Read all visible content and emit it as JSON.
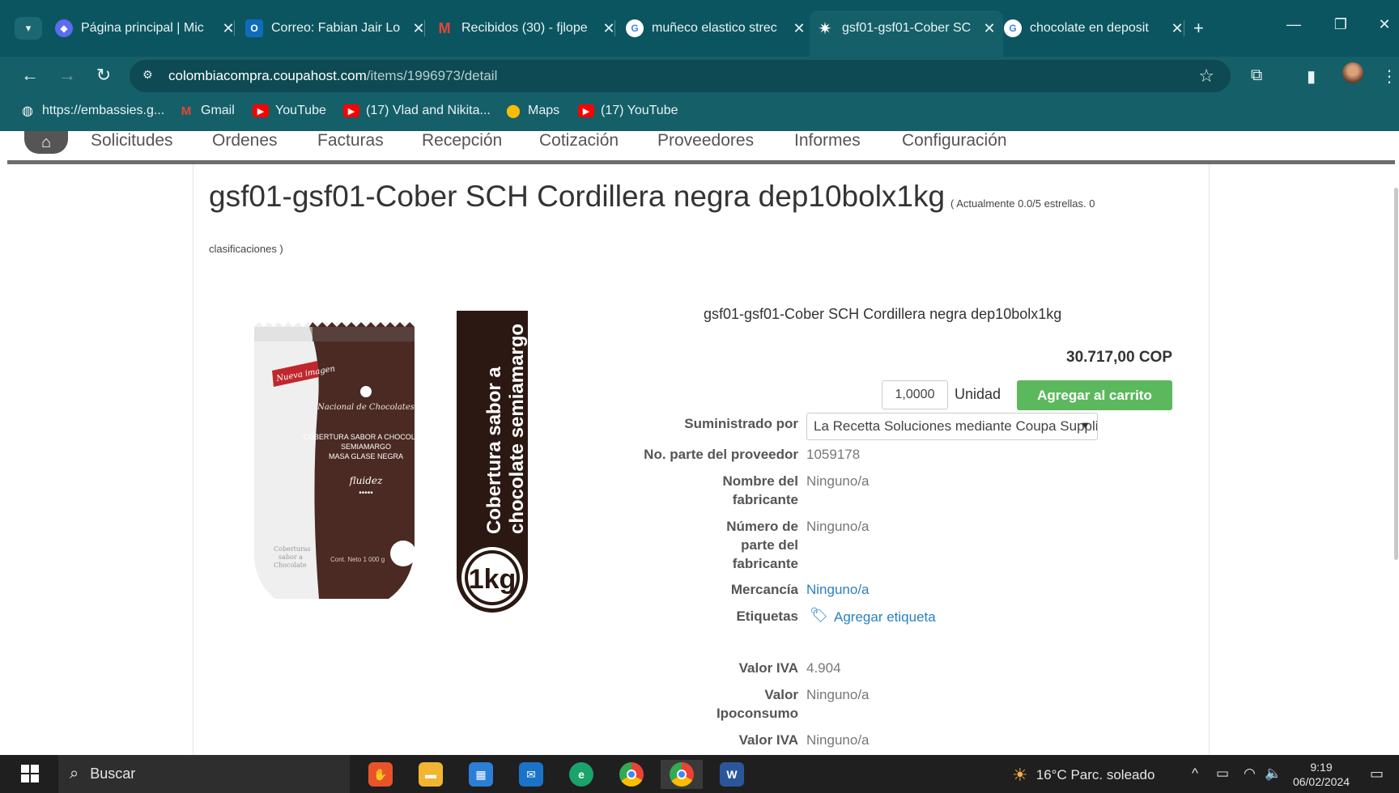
{
  "browser": {
    "tabs": [
      {
        "label": "Página principal | Mic",
        "icon": "copilot-icon",
        "color": "#5b6cf0"
      },
      {
        "label": "Correo: Fabian Jair Lo",
        "icon": "outlook-icon",
        "color": "#0f6cbd"
      },
      {
        "label": "Recibidos (30) - fjlope",
        "icon": "gmail-icon",
        "color": "#ea4335"
      },
      {
        "label": "muñeco elastico strec",
        "icon": "google-icon",
        "color": "#4285f4"
      },
      {
        "label": "gsf01-gsf01-Cober SC",
        "icon": "coupa-icon",
        "color": "#ffffff"
      },
      {
        "label": "chocolate en deposit",
        "icon": "google-icon",
        "color": "#4285f4"
      }
    ],
    "url_host": "colombiacompra.coupahost.com",
    "url_path": "/items/1996973/detail",
    "bookmarks": [
      {
        "label": "https://embassies.g...",
        "icon": "globe-icon"
      },
      {
        "label": "Gmail",
        "icon": "gmail-icon"
      },
      {
        "label": "YouTube",
        "icon": "youtube-icon"
      },
      {
        "label": "(17) Vlad and Nikita...",
        "icon": "youtube-icon"
      },
      {
        "label": "Maps",
        "icon": "maps-icon"
      },
      {
        "label": "(17) YouTube",
        "icon": "youtube-icon"
      }
    ]
  },
  "app_nav": {
    "items": [
      "Solicitudes",
      "Ordenes",
      "Facturas",
      "Recepción",
      "Cotización",
      "Proveedores",
      "Informes",
      "Configuración"
    ]
  },
  "product": {
    "title": "gsf01-gsf01-Cober SCH Cordillera negra dep10bolx1kg",
    "rating_line1": "( Actualmente 0.0/5 estrellas. 0",
    "rating_line2": "clasificaciones )",
    "subtitle": "gsf01-gsf01-Cober SCH Cordillera negra dep10bolx1kg",
    "price": "30.717,00 COP",
    "quantity": "1,0000",
    "unit": "Unidad",
    "add_to_cart": "Agregar al carrito",
    "image": {
      "badge": "Nueva imagen",
      "brand": "Nacional de Chocolates",
      "desc_line1": "COBERTURA SABOR A CHOCOLATE",
      "desc_line2": "SEMIAMARGO",
      "desc_line3": "MASA GLASE NEGRA",
      "fluidez": "fluidez",
      "side_text": "Coberturas sabor a Chocolate",
      "net": "Cont. Neto 1 000 g",
      "vertical_text_1": "Cobertura sabor a",
      "vertical_text_2": "chocolate semiamargo",
      "weight": "1kg"
    },
    "fields": {
      "supplier_label": "Suministrado por",
      "supplier_value": "La Recetta Soluciones mediante Coupa Supplier",
      "part_label": "No. parte del proveedor",
      "part_value": "1059178",
      "manufacturer_label_1": "Nombre del",
      "manufacturer_label_2": "fabricante",
      "manufacturer_value": "Ninguno/a",
      "mfr_part_label_1": "Número de",
      "mfr_part_label_2": "parte del",
      "mfr_part_label_3": "fabricante",
      "mfr_part_value": "Ninguno/a",
      "commodity_label": "Mercancía",
      "commodity_value": "Ninguno/a",
      "tags_label": "Etiquetas",
      "tags_value": "Agregar etiqueta",
      "iva_label": "Valor IVA",
      "iva_value": "4.904",
      "ipoconsumo_label_1": "Valor",
      "ipoconsumo_label_2": "Ipoconsumo",
      "ipoconsumo_value": "Ninguno/a",
      "iva2_label": "Valor IVA",
      "iva2_value": "Ninguno/a"
    }
  },
  "taskbar": {
    "search_label": "Buscar",
    "weather": "16°C  Parc. soleado",
    "time": "9:19",
    "date": "06/02/2024"
  }
}
